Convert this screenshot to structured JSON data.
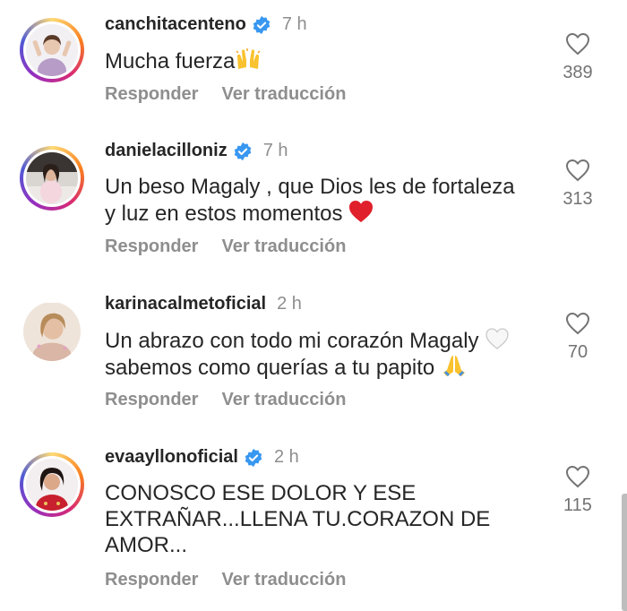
{
  "comments": [
    {
      "username": "canchitacenteno",
      "verified": true,
      "time": "7 h",
      "text": "Mucha fuerza",
      "emoji": "raised-hands",
      "reply_label": "Responder",
      "translate_label": "Ver traducción",
      "likes": "389",
      "story_ring": true
    },
    {
      "username": "danielacilloniz",
      "verified": true,
      "time": "7 h",
      "text_line1": "Un beso Magaly , que Dios les de fortaleza",
      "text_line2": "y luz en estos momentos",
      "emoji": "red-heart",
      "reply_label": "Responder",
      "translate_label": "Ver traducción",
      "likes": "313",
      "story_ring": true
    },
    {
      "username": "karinacalmetoficial",
      "verified": false,
      "time": "2 h",
      "text_line1": "Un abrazo con todo mi corazón Magaly",
      "text_line2": "sabemos como querías a tu papito",
      "emoji1": "white-heart",
      "emoji2": "folded-hands",
      "reply_label": "Responder",
      "translate_label": "Ver traducción",
      "likes": "70",
      "story_ring": false
    },
    {
      "username": "evaayllonoficial",
      "verified": true,
      "time": "2 h",
      "text_line1": "CONOSCO ESE DOLOR Y ESE",
      "text_line2": "EXTRAÑAR...LLENA TU.CORAZON DE",
      "text_line3": "AMOR...",
      "reply_label": "Responder",
      "translate_label": "Ver traducción",
      "likes": "115",
      "story_ring": true
    }
  ],
  "colors": {
    "text": "#262626",
    "secondary": "#8e8e8e",
    "verified_blue": "#3897f0"
  }
}
